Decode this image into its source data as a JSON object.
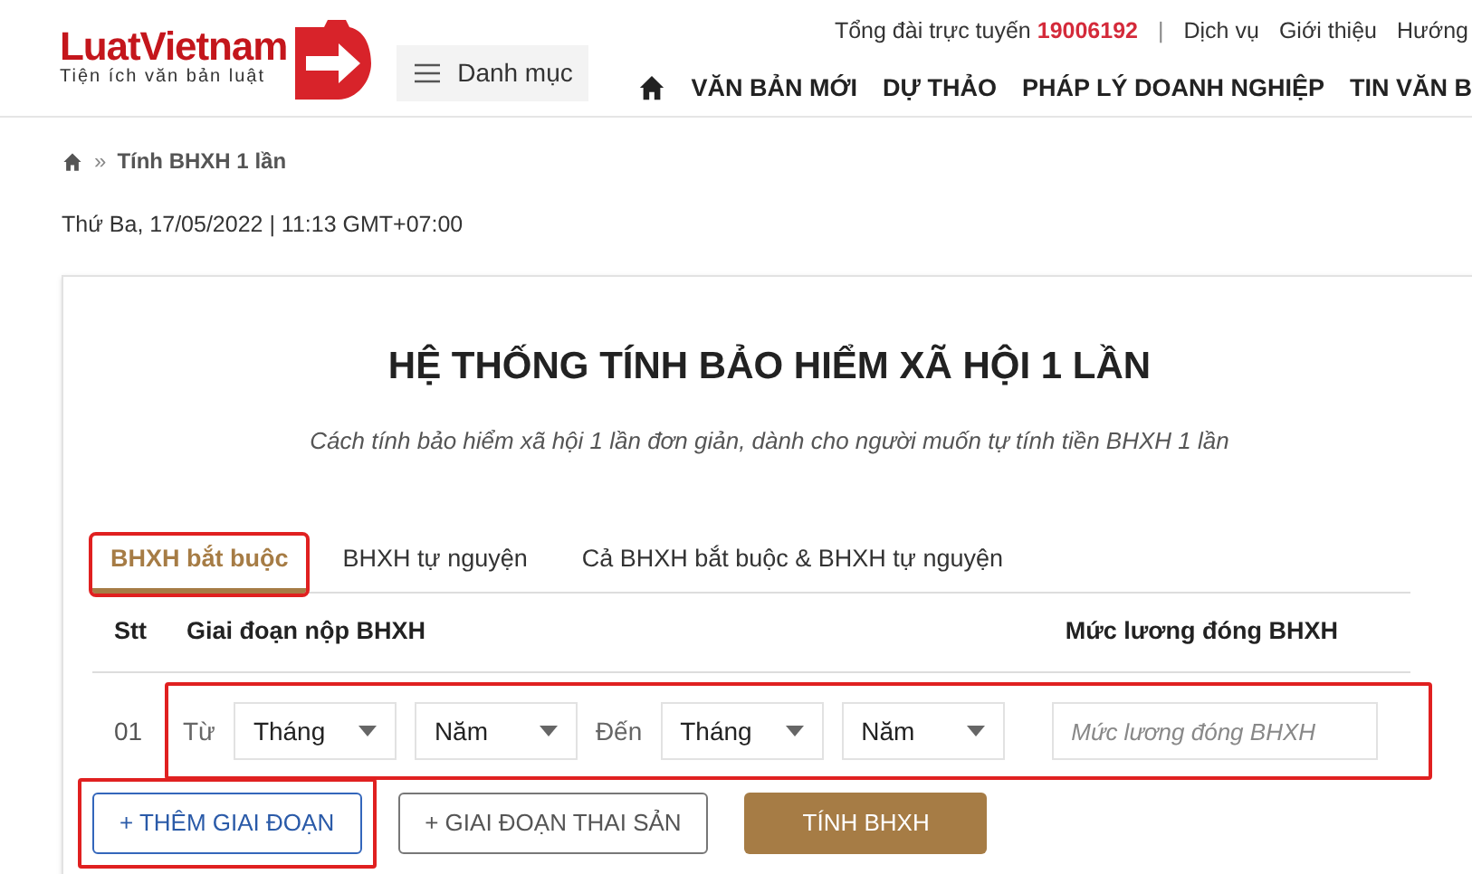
{
  "logo": {
    "name": "LuatVietnam",
    "tagline": "Tiện ích văn bản luật"
  },
  "menu_button": {
    "label": "Danh mục"
  },
  "top_links": {
    "hotline_label": "Tổng đài trực tuyến",
    "hotline_number": "19006192",
    "separator": "|",
    "links": [
      "Dịch vụ",
      "Giới thiệu",
      "Hướng"
    ]
  },
  "nav": [
    "VĂN BẢN MỚI",
    "DỰ THẢO",
    "PHÁP LÝ DOANH NGHIỆP",
    "TIN VĂN B"
  ],
  "breadcrumb": {
    "separator": "»",
    "current": "Tính BHXH 1 lần"
  },
  "date": "Thứ Ba, 17/05/2022 | 11:13 GMT+07:00",
  "calculator": {
    "title": "HỆ THỐNG TÍNH BẢO HIỂM XÃ HỘI 1 LẦN",
    "subtitle": "Cách tính bảo hiểm xã hội 1 lần đơn giản, dành cho người muốn tự tính tiền BHXH 1 lần",
    "tabs": [
      {
        "label": "BHXH bắt buộc",
        "selected": true,
        "highlighted": true
      },
      {
        "label": "BHXH tự nguyện",
        "selected": false,
        "highlighted": false
      },
      {
        "label": "Cả BHXH bắt buộc & BHXH tự nguyện",
        "selected": false,
        "highlighted": false
      }
    ],
    "columns": [
      "Stt",
      "Giai đoạn nộp BHXH",
      "Mức lương đóng BHXH"
    ],
    "rows": [
      {
        "index": "01",
        "from_label": "Từ",
        "from_month": "Tháng",
        "from_year": "Năm",
        "to_label": "Đến",
        "to_month": "Tháng",
        "to_year": "Năm",
        "salary_placeholder": "Mức lương đóng BHXH",
        "highlighted": true
      }
    ],
    "buttons": [
      {
        "label": "+ THÊM GIAI ĐOẠN",
        "kind": "outline-blue",
        "highlighted": true
      },
      {
        "label": "+ GIAI ĐOẠN THAI SẢN",
        "kind": "outline-gray",
        "highlighted": false
      },
      {
        "label": "TÍNH BHXH",
        "kind": "primary",
        "highlighted": false
      }
    ]
  }
}
